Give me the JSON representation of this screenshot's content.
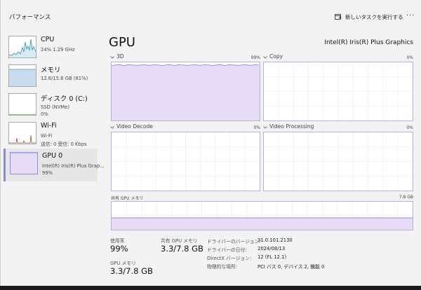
{
  "window": {
    "title": "パフォーマンス"
  },
  "toolbar": {
    "run_task_label": "新しいタスクを実行する",
    "run_task_icon": "run-task-icon",
    "more_label": "..."
  },
  "sidebar": {
    "items": [
      {
        "name": "CPU",
        "sub1": "24%  1.29 GHz",
        "sub2": "",
        "sub3": ""
      },
      {
        "name": "メモリ",
        "sub1": "12.6/15.6 GB (81%)",
        "sub2": "",
        "sub3": ""
      },
      {
        "name": "ディスク 0 (C:)",
        "sub1": "SSD (NVMe)",
        "sub2": "0%",
        "sub3": ""
      },
      {
        "name": "Wi-Fi",
        "sub1": "Wi-Fi",
        "sub2": "送信: 0  受信: 0 Kbps",
        "sub3": ""
      },
      {
        "name": "GPU 0",
        "sub1": "Intel(R) Iris(R) Plus Grap...",
        "sub2": "99%",
        "sub3": ""
      }
    ]
  },
  "main": {
    "title": "GPU",
    "adapter": "Intel(R) Iris(R) Plus Graphics",
    "engines": [
      {
        "label": "3D",
        "percent": "99%",
        "value": 99
      },
      {
        "label": "Copy",
        "percent": "0%",
        "value": 0
      },
      {
        "label": "Video Decode",
        "percent": "0%",
        "value": 0
      },
      {
        "label": "Video Processing",
        "percent": "0%",
        "value": 0
      }
    ],
    "shared_memory": {
      "label": "共有 GPU メモリ",
      "max": "7.8 GB"
    },
    "stats": {
      "usage_label": "使用率",
      "usage_value": "99%",
      "shared_label": "共有 GPU メモリ",
      "shared_value": "3.3/7.8 GB",
      "gpu_mem_label": "GPU メモリ",
      "gpu_mem_value": "3.3/7.8 GB"
    },
    "info": {
      "driver_version_label": "ドライバーのバージョン:",
      "driver_version": "31.0.101.2130",
      "driver_date_label": "ドライバーの日付:",
      "driver_date": "2024/08/13",
      "directx_label": "DirectX バージョン:",
      "directx": "12 (FL 12.1)",
      "location_label": "物理的な場所:",
      "location": "PCI バス 0, デバイス 2, 機能 0"
    }
  },
  "colors": {
    "gpu_accent": "#8e8cd8",
    "gpu_fill": "#e7dcf6",
    "cpu_line": "#2e8fb5",
    "mem_fill": "#c8dcf0"
  }
}
